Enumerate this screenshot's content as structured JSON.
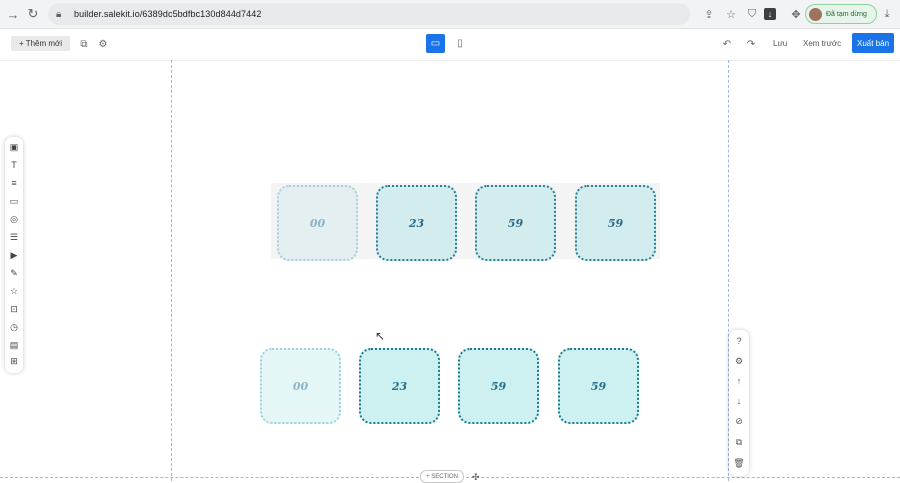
{
  "browser": {
    "url": "builder.salekit.io/6389dc5bdfbc130d844d7442",
    "profile_label": "Đã tạm dừng",
    "icons": [
      "back-icon",
      "reload-icon",
      "lock-icon",
      "share-icon",
      "star-icon",
      "shield-icon",
      "download-square-icon",
      "extensions-icon",
      "download-icon"
    ]
  },
  "toolbar": {
    "add_label": "+ Thêm mới",
    "save_label": "Lưu",
    "preview_label": "Xem trước",
    "publish_label": "Xuất bản"
  },
  "left_panel": {
    "items": [
      "image-icon",
      "text-icon",
      "paragraph-icon",
      "button-icon",
      "shape-icon",
      "form-icon",
      "video-icon",
      "pen-icon",
      "star-icon",
      "popup-icon",
      "timer-icon",
      "gallery-icon",
      "grid-icon"
    ]
  },
  "right_panel": {
    "items": [
      "help-icon",
      "settings-icon",
      "arrow-up-icon",
      "arrow-down-icon",
      "hide-icon",
      "copy-icon",
      "trash-icon"
    ]
  },
  "countdown_top": {
    "values": [
      "00",
      "23",
      "59",
      "59"
    ]
  },
  "countdown_bottom": {
    "values": [
      "00",
      "23",
      "59",
      "59"
    ]
  },
  "section_tag": "+ SECTION",
  "colors": {
    "accent": "#1a73e8",
    "box_border_dark": "#2d7d97",
    "box_fill_light": "#d3ecee"
  }
}
